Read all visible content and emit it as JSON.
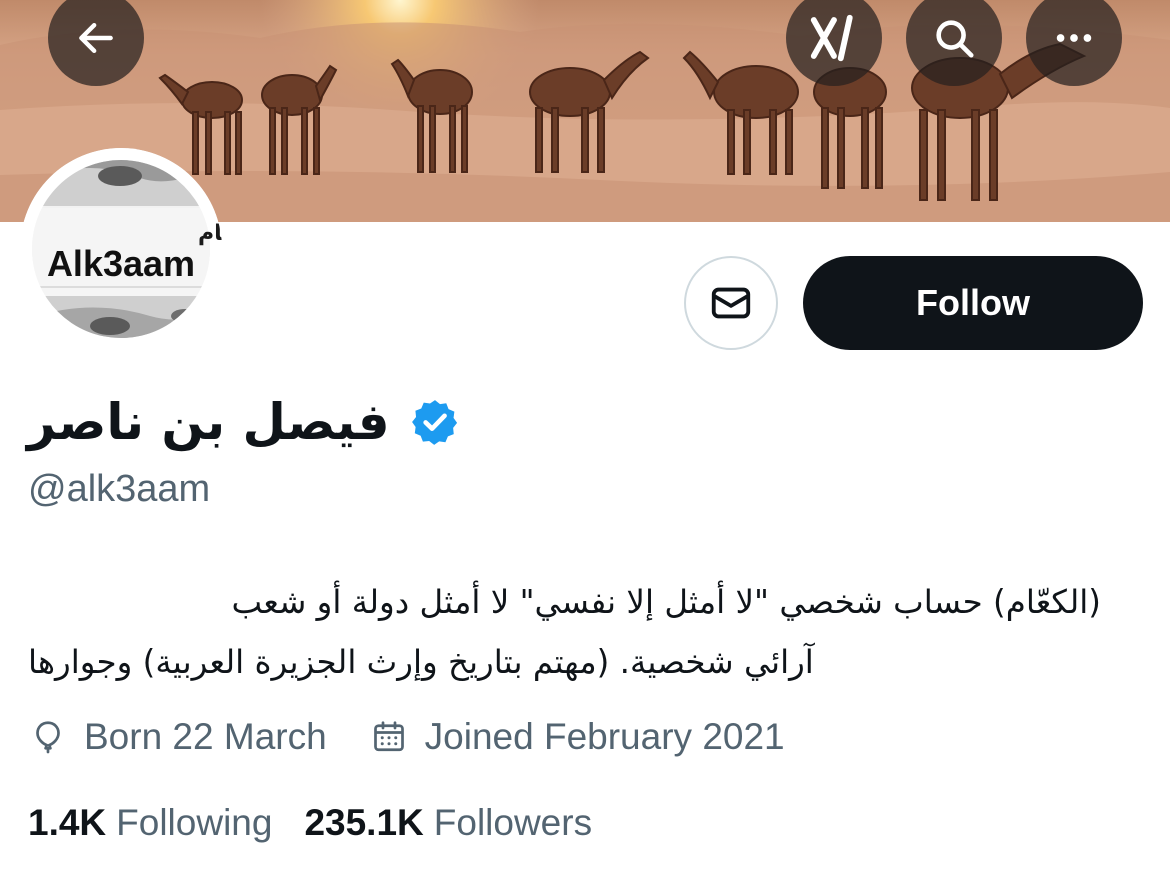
{
  "header": {
    "back_icon": "arrow-left-icon",
    "grok_icon": "grok-logo-icon",
    "search_icon": "search-icon",
    "more_icon": "more-horizontal-icon",
    "banner_description_icon": "banner-image"
  },
  "avatar": {
    "brand_arabic": "الكعّام",
    "brand_latin": "Alk3aam"
  },
  "actions": {
    "message_icon": "envelope-icon",
    "follow_label": "Follow"
  },
  "profile": {
    "display_name": "فيصل بن ناصر",
    "handle": "@alk3aam",
    "verified_icon": "verified-badge-icon",
    "bio_line_1": "(الكعّام) حساب شخصي \"لا أمثل إلا نفسي\" لا أمثل دولة أو شعب",
    "bio_line_2": "آرائي شخصية. (مهتم بتاريخ وإرث الجزيرة العربية) وجوارها",
    "born_label": "Born 22 March",
    "joined_label": "Joined February 2021"
  },
  "stats": {
    "following_count": "1.4K",
    "following_label": "Following",
    "followers_count": "235.1K",
    "followers_label": "Followers"
  },
  "colors": {
    "text_primary": "#0f1419",
    "text_secondary": "#536471",
    "verified_blue": "#1d9bf0",
    "follow_button_bg": "#0f1419",
    "border": "#cfd9de"
  }
}
